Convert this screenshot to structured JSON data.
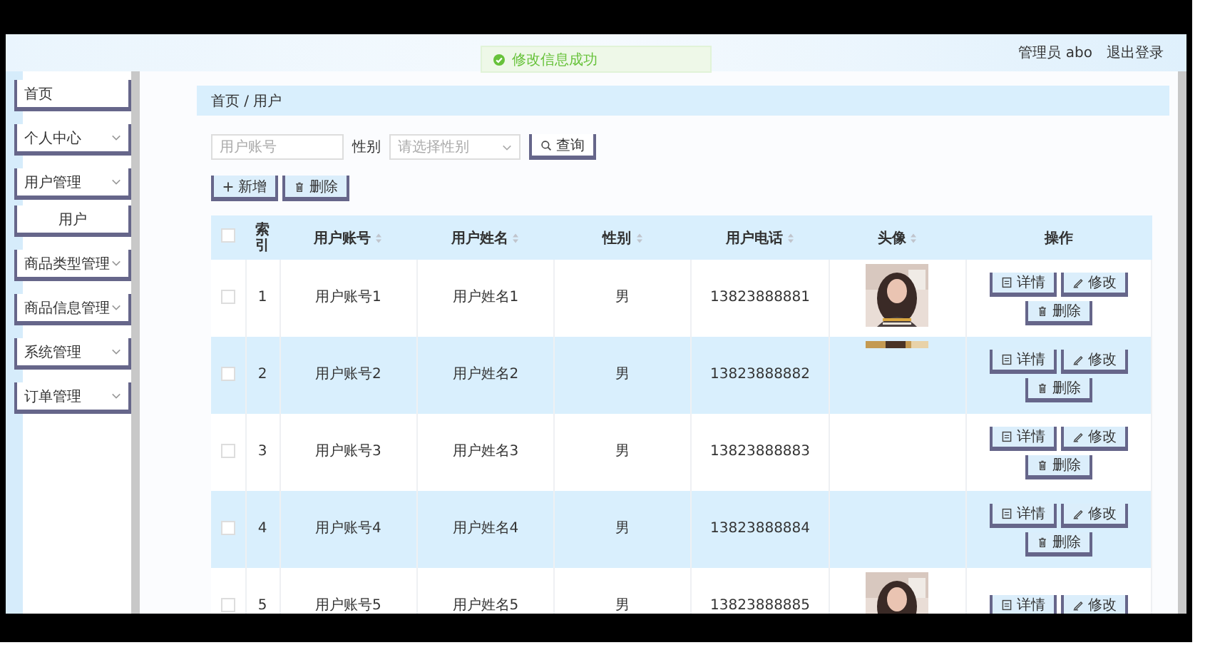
{
  "header": {
    "toast": "修改信息成功",
    "user": "管理员 abo",
    "logout": "退出登录"
  },
  "sidebar": {
    "items": [
      {
        "label": "首页",
        "kind": "link"
      },
      {
        "label": "个人中心",
        "kind": "group"
      },
      {
        "label": "用户管理",
        "kind": "group"
      },
      {
        "label": "用户",
        "kind": "sub"
      },
      {
        "label": "商品类型管理",
        "kind": "group"
      },
      {
        "label": "商品信息管理",
        "kind": "group"
      },
      {
        "label": "系统管理",
        "kind": "group"
      },
      {
        "label": "订单管理",
        "kind": "group"
      }
    ]
  },
  "breadcrumb": [
    "首页",
    "/",
    "用户"
  ],
  "search": {
    "account": {
      "placeholder": "用户账号"
    },
    "gender_label": "性别",
    "gender": {
      "placeholder": "请选择性别"
    },
    "button": "查询"
  },
  "toolbar": [
    {
      "label": "新增",
      "kind": "add"
    },
    {
      "label": "删除",
      "kind": "delete"
    }
  ],
  "table": {
    "header_checked": false,
    "columns": [
      {
        "kind": "check"
      },
      {
        "label": "索引",
        "kind": "plain"
      },
      {
        "label": "用户账号",
        "kind": "sort"
      },
      {
        "label": "用户姓名",
        "kind": "sort"
      },
      {
        "label": "性别",
        "kind": "sort"
      },
      {
        "label": "用户电话",
        "kind": "sort"
      },
      {
        "label": "头像",
        "kind": "sort"
      },
      {
        "label": "操作",
        "kind": "plain"
      }
    ],
    "rows": [
      {
        "checked": false,
        "index": "1",
        "account": "用户账号1",
        "name": "用户姓名1",
        "gender": "男",
        "phone": "13823888881",
        "avatar": {
          "kind": "picture",
          "partial": false
        },
        "actions": [
          {
            "label": "详情",
            "kind": "detail"
          },
          {
            "label": "修改",
            "kind": "edit"
          },
          {
            "label": "删除",
            "kind": "delete"
          }
        ]
      },
      {
        "checked": false,
        "index": "2",
        "account": "用户账号2",
        "name": "用户姓名2",
        "gender": "男",
        "phone": "13823888882",
        "avatar": {
          "kind": "picture",
          "partial": true
        },
        "actions": [
          {
            "label": "详情",
            "kind": "detail"
          },
          {
            "label": "修改",
            "kind": "edit"
          },
          {
            "label": "删除",
            "kind": "delete"
          }
        ]
      },
      {
        "checked": false,
        "index": "3",
        "account": "用户账号3",
        "name": "用户姓名3",
        "gender": "男",
        "phone": "13823888883",
        "actions": [
          {
            "label": "详情",
            "kind": "detail"
          },
          {
            "label": "修改",
            "kind": "edit"
          },
          {
            "label": "删除",
            "kind": "delete"
          }
        ]
      },
      {
        "checked": false,
        "index": "4",
        "account": "用户账号4",
        "name": "用户姓名4",
        "gender": "男",
        "phone": "13823888884",
        "actions": [
          {
            "label": "详情",
            "kind": "detail"
          },
          {
            "label": "修改",
            "kind": "edit"
          },
          {
            "label": "删除",
            "kind": "delete"
          }
        ]
      },
      {
        "checked": false,
        "index": "5",
        "account": "用户账号5",
        "name": "用户姓名5",
        "gender": "男",
        "phone": "13823888885",
        "avatar": {
          "kind": "picture",
          "partial": false
        },
        "actions": [
          {
            "label": "详情",
            "kind": "detail"
          },
          {
            "label": "修改",
            "kind": "edit"
          }
        ]
      }
    ]
  }
}
